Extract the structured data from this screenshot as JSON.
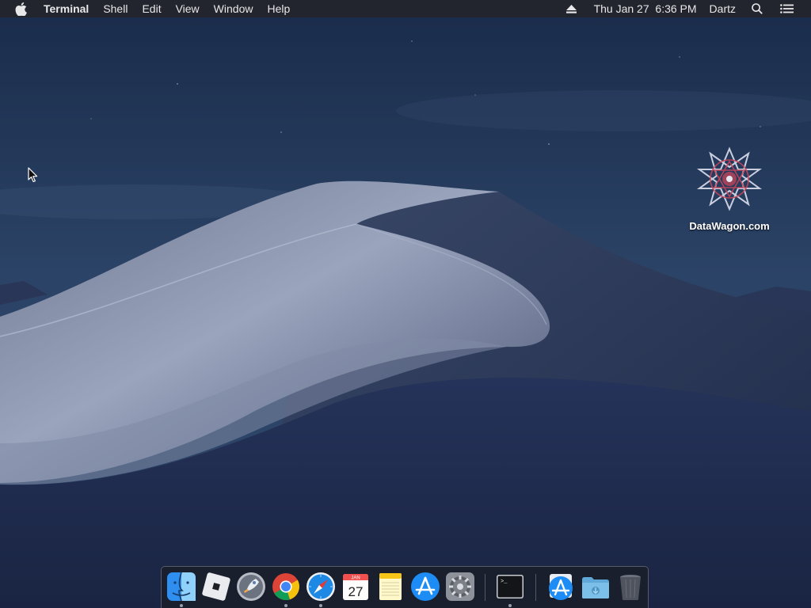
{
  "menubar": {
    "app_name": "Terminal",
    "menus": [
      "Shell",
      "Edit",
      "View",
      "Window",
      "Help"
    ],
    "datetime": "Thu Jan 27  6:36 PM",
    "user": "Dartz",
    "icons": [
      "apple-logo-icon",
      "eject-icon",
      "search-icon",
      "notification-list-icon"
    ]
  },
  "desktop": {
    "icon_label": "DataWagon.com",
    "icon_name": "datawagon-emblem-icon"
  },
  "dock": {
    "apps": [
      {
        "id": "finder",
        "running": true
      },
      {
        "id": "roblox",
        "running": false
      },
      {
        "id": "launchpad",
        "running": false
      },
      {
        "id": "chrome",
        "running": true
      },
      {
        "id": "safari",
        "running": true
      },
      {
        "id": "calendar",
        "running": false,
        "month": "JAN",
        "day": "27"
      },
      {
        "id": "notes",
        "running": false
      },
      {
        "id": "app-store",
        "running": false
      },
      {
        "id": "system-preferences",
        "running": false
      },
      {
        "id": "terminal",
        "running": true,
        "prompt": ">_"
      },
      {
        "id": "app-store-download",
        "running": false
      },
      {
        "id": "downloads-folder",
        "running": false
      },
      {
        "id": "trash",
        "running": false
      }
    ]
  },
  "colors": {
    "menubar_bg": "#23252a",
    "sky": "#243a5e",
    "dune_light": "#8d98b3",
    "dune_dark": "#1d2946"
  }
}
